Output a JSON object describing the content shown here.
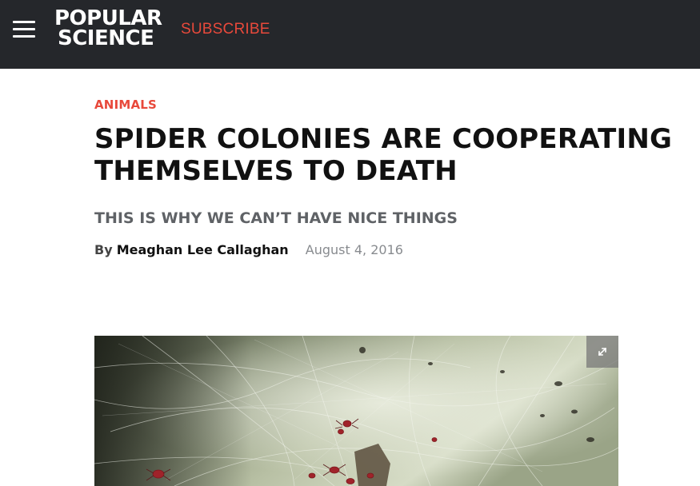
{
  "header": {
    "logo_line1": "POPULAR",
    "logo_line2": "SCIENCE",
    "subscribe_label": "SUBSCRIBE",
    "background_color": "#25272b",
    "accent_color": "#e8493b"
  },
  "article": {
    "category": "ANIMALS",
    "headline": "SPIDER COLONIES ARE COOPERATING THEMSELVES TO DEATH",
    "dek": "THIS IS WHY WE CAN’T HAVE NICE THINGS",
    "byline_prefix": "By",
    "author": "Meaghan Lee Callaghan",
    "date": "August 4, 2016"
  },
  "hero_image": {
    "subject": "red spiders on a dense web",
    "expand_icon": "expand-icon"
  },
  "icons": {
    "menu": "hamburger-menu-icon",
    "expand": "expand-icon"
  }
}
